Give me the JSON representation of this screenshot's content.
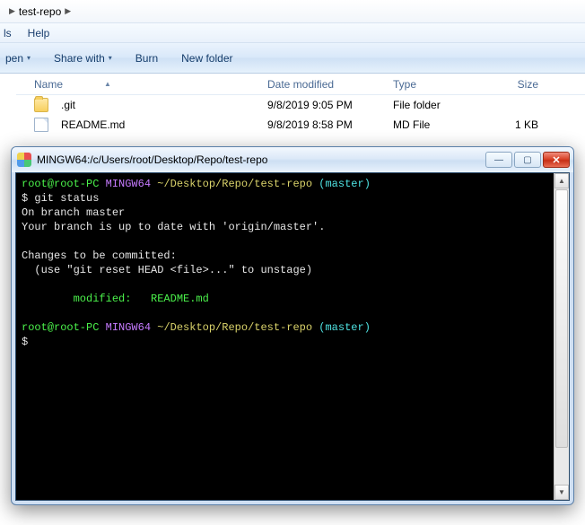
{
  "breadcrumb": {
    "current": "test-repo"
  },
  "menubar": {
    "item0": "ls",
    "item1": "Help"
  },
  "toolbar": {
    "open": "pen",
    "share": "Share with",
    "burn": "Burn",
    "newfolder": "New folder"
  },
  "columns": {
    "name": "Name",
    "date": "Date modified",
    "type": "Type",
    "size": "Size"
  },
  "files": [
    {
      "name": ".git",
      "date": "9/8/2019 9:05 PM",
      "type": "File folder",
      "size": "",
      "kind": "folder"
    },
    {
      "name": "README.md",
      "date": "9/8/2019 8:58 PM",
      "type": "MD File",
      "size": "1 KB",
      "kind": "file"
    }
  ],
  "terminal": {
    "title": "MINGW64:/c/Users/root/Desktop/Repo/test-repo",
    "prompt_user": "root@root-PC",
    "prompt_shell": "MINGW64",
    "prompt_path": "~/Desktop/Repo/test-repo",
    "prompt_branch": "(master)",
    "cmd1": "$ git status",
    "line_branch": "On branch master",
    "line_uptodate": "Your branch is up to date with 'origin/master'.",
    "line_changes_hdr": "Changes to be committed:",
    "line_changes_hint": "  (use \"git reset HEAD <file>...\" to unstage)",
    "line_modified": "        modified:   README.md",
    "prompt2_dollar": "$"
  }
}
